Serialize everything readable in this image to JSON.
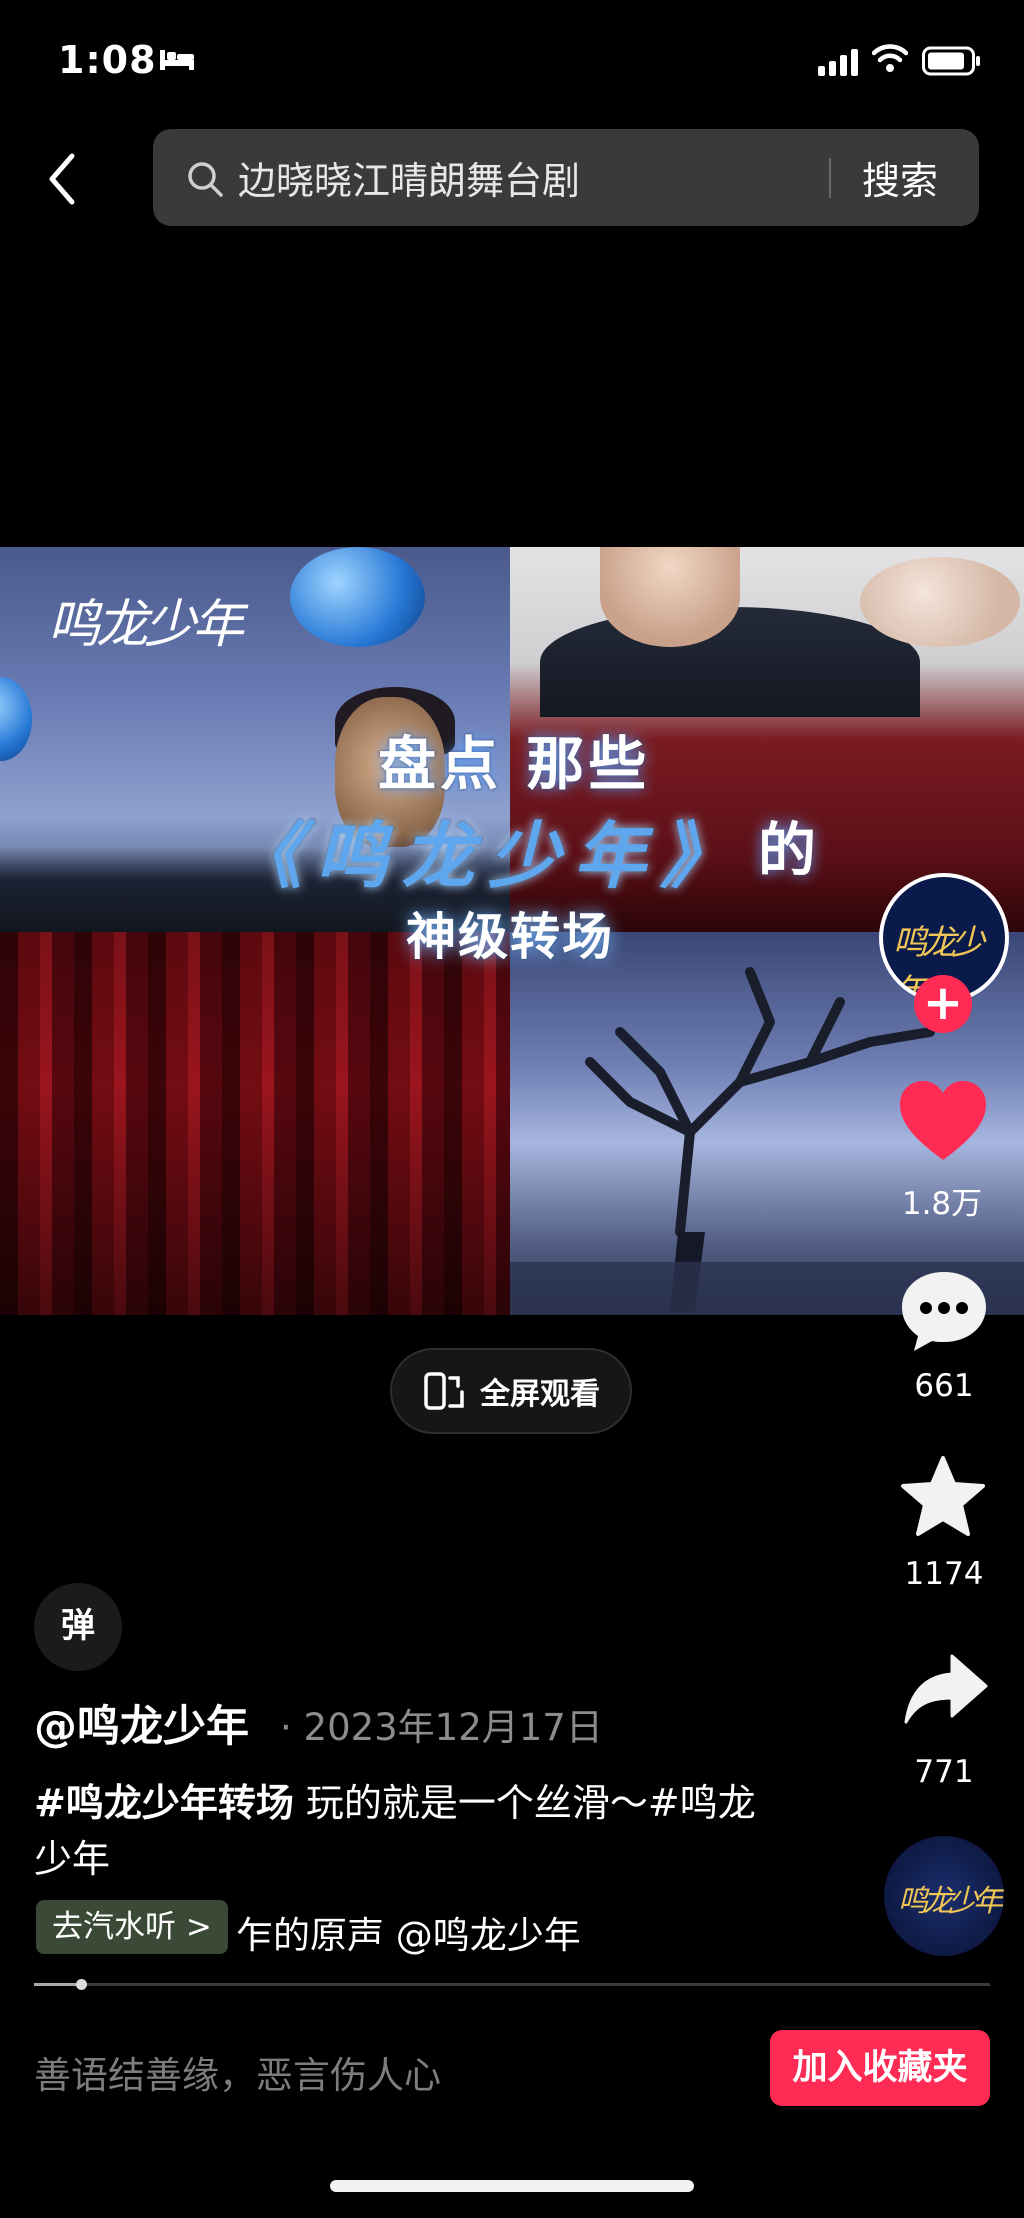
{
  "status_bar": {
    "time": "1:08"
  },
  "search": {
    "query": "边晓晓江晴朗舞台剧",
    "button": "搜索"
  },
  "video": {
    "logo": "鸣龙少年",
    "overlay_line1": "盘点 那些",
    "overlay_line2": "《鸣龙少年》",
    "overlay_line2_suffix": "的",
    "overlay_line3": "神级转场",
    "fullscreen_label": "全屏观看",
    "progress": 0.05
  },
  "actions": {
    "avatar_text": "鸣龙少年",
    "likes": "1.8万",
    "comments": "661",
    "favorites": "1174",
    "shares": "771"
  },
  "info": {
    "danmu": "弹",
    "author": "@鸣龙少年",
    "date": "· 2023年12月17日",
    "caption_tag": "#鸣龙少年转场",
    "caption_text": "  玩的就是一个丝滑～#鸣龙少年",
    "music_tag": "去汽水听 >",
    "music_text": "乍的原声    @鸣龙少年"
  },
  "bottom": {
    "comment_placeholder": "善语结善缘，恶言伤人心",
    "collect_button": "加入收藏夹"
  },
  "colors": {
    "accent": "#fe2c55",
    "background": "#000000"
  }
}
